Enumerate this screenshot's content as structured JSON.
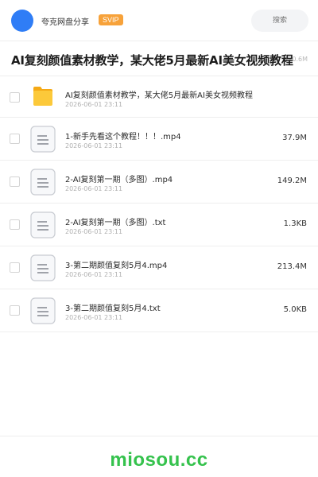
{
  "header": {
    "brand": "夸克网盘分享",
    "badge": "SVIP",
    "search_placeholder": "搜索"
  },
  "share": {
    "title": "AI复刻颜值素材教学，某大佬5月最新AI美女视频教程",
    "total_size": "420.6M"
  },
  "files": [
    {
      "type": "folder",
      "name": "AI复刻颜值素材教学，某大佬5月最新AI美女视频教程",
      "date": "2026-06-01 23:11",
      "size": ""
    },
    {
      "type": "file",
      "name": "1-新手先看这个教程！！！.mp4",
      "date": "2026-06-01 23:11",
      "size": "37.9M"
    },
    {
      "type": "file",
      "name": "2-AI复刻第一期（多图）.mp4",
      "date": "2026-06-01 23:11",
      "size": "149.2M"
    },
    {
      "type": "file",
      "name": "2-AI复刻第一期（多图）.txt",
      "date": "2026-06-01 23:11",
      "size": "1.3KB"
    },
    {
      "type": "file",
      "name": "3-第二期颜值复刻5月4.mp4",
      "date": "2026-06-01 23:11",
      "size": "213.4M"
    },
    {
      "type": "file",
      "name": "3-第二期颜值复刻5月4.txt",
      "date": "2026-06-01 23:11",
      "size": "5.0KB"
    }
  ],
  "footer": {
    "watermark": "miosou.cc"
  },
  "colors": {
    "avatar": "#2f7df6",
    "badge": "#f7a23a",
    "folder": "#fbbf24",
    "watermark": "#35c24d"
  },
  "icons": {
    "folder": "folder-icon",
    "file": "document-icon"
  }
}
